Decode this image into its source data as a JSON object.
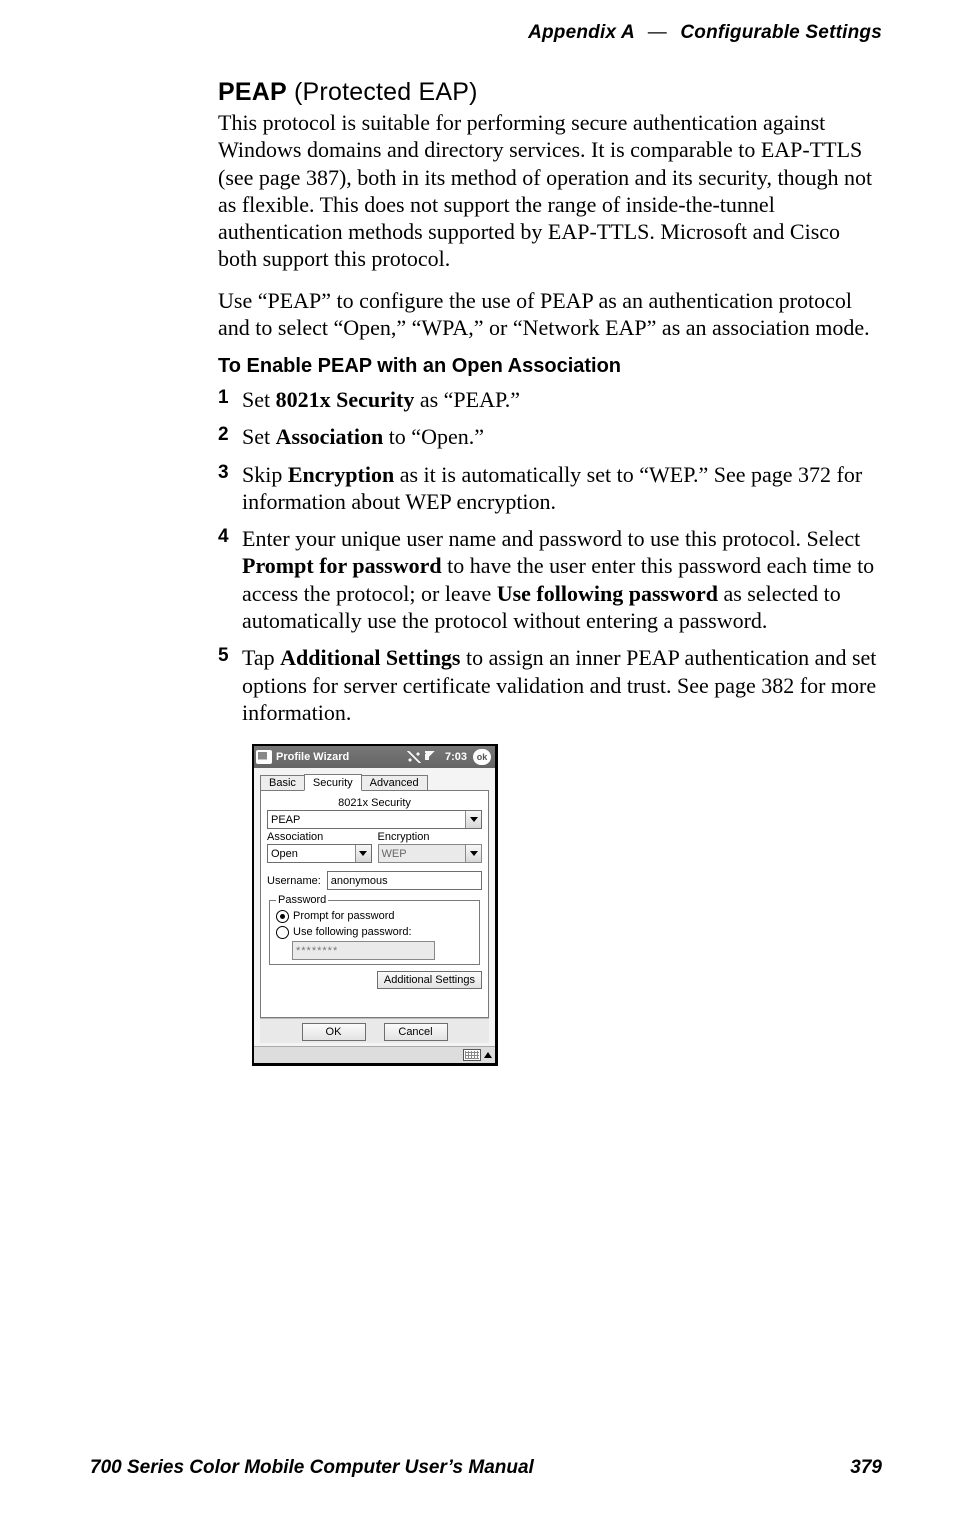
{
  "header": {
    "appendix": "Appendix A",
    "dash": "—",
    "section": "Configurable Settings"
  },
  "title": {
    "bold": "PEAP",
    "paren": " (Protected EAP)"
  },
  "paragraphs": {
    "p1": "This protocol is suitable for performing secure authentication against Windows domains and directory services. It is comparable to EAP-TTLS (see page 387), both in its method of operation and its security, though not as flexible. This does not support the range of inside-the-tunnel authentication methods supported by EAP-TTLS. Microsoft and Cisco both support this protocol.",
    "p2": "Use “PEAP” to configure the use of PEAP as an authentication protocol and to select “Open,” “WPA,” or “Network EAP” as an association mode."
  },
  "subhead": "To Enable PEAP with an Open Association",
  "steps": [
    {
      "pre": "Set ",
      "bold": "8021x Security",
      "post": " as “PEAP.”"
    },
    {
      "pre": "Set ",
      "bold": "Association",
      "post": " to “Open.”"
    },
    {
      "pre": "Skip ",
      "bold": "Encryption",
      "post": " as it is automatically set to “WEP.” See page 372 for information about WEP encryption."
    },
    {
      "pre": "Enter your unique user name and password to use this protocol. Select ",
      "bold": "Prompt for password",
      "mid": " to have the user enter this password each time to access the protocol; or leave ",
      "bold2": "Use following password",
      "post": " as selected to automatically use the protocol without entering a password."
    },
    {
      "pre": "Tap ",
      "bold": "Additional Settings",
      "post": " to assign an inner PEAP authentication and set options for server certificate validation and trust. See page 382 for more information."
    }
  ],
  "mock": {
    "title": "Profile Wizard",
    "clock": "7:03",
    "ok": "ok",
    "tabs": [
      "Basic",
      "Security",
      "Advanced"
    ],
    "active_tab": "Security",
    "section_label": "8021x Security",
    "security_value": "PEAP",
    "assoc_label": "Association",
    "assoc_value": "Open",
    "enc_label": "Encryption",
    "enc_value": "WEP",
    "user_label": "Username:",
    "user_value": "anonymous",
    "pw_legend": "Password",
    "radio_prompt": "Prompt for password",
    "radio_use": "Use following password:",
    "pw_masked": "********",
    "additional_btn": "Additional Settings",
    "ok_btn": "OK",
    "cancel_btn": "Cancel"
  },
  "footer": {
    "left": "700 Series Color Mobile Computer User’s Manual",
    "right": "379"
  }
}
